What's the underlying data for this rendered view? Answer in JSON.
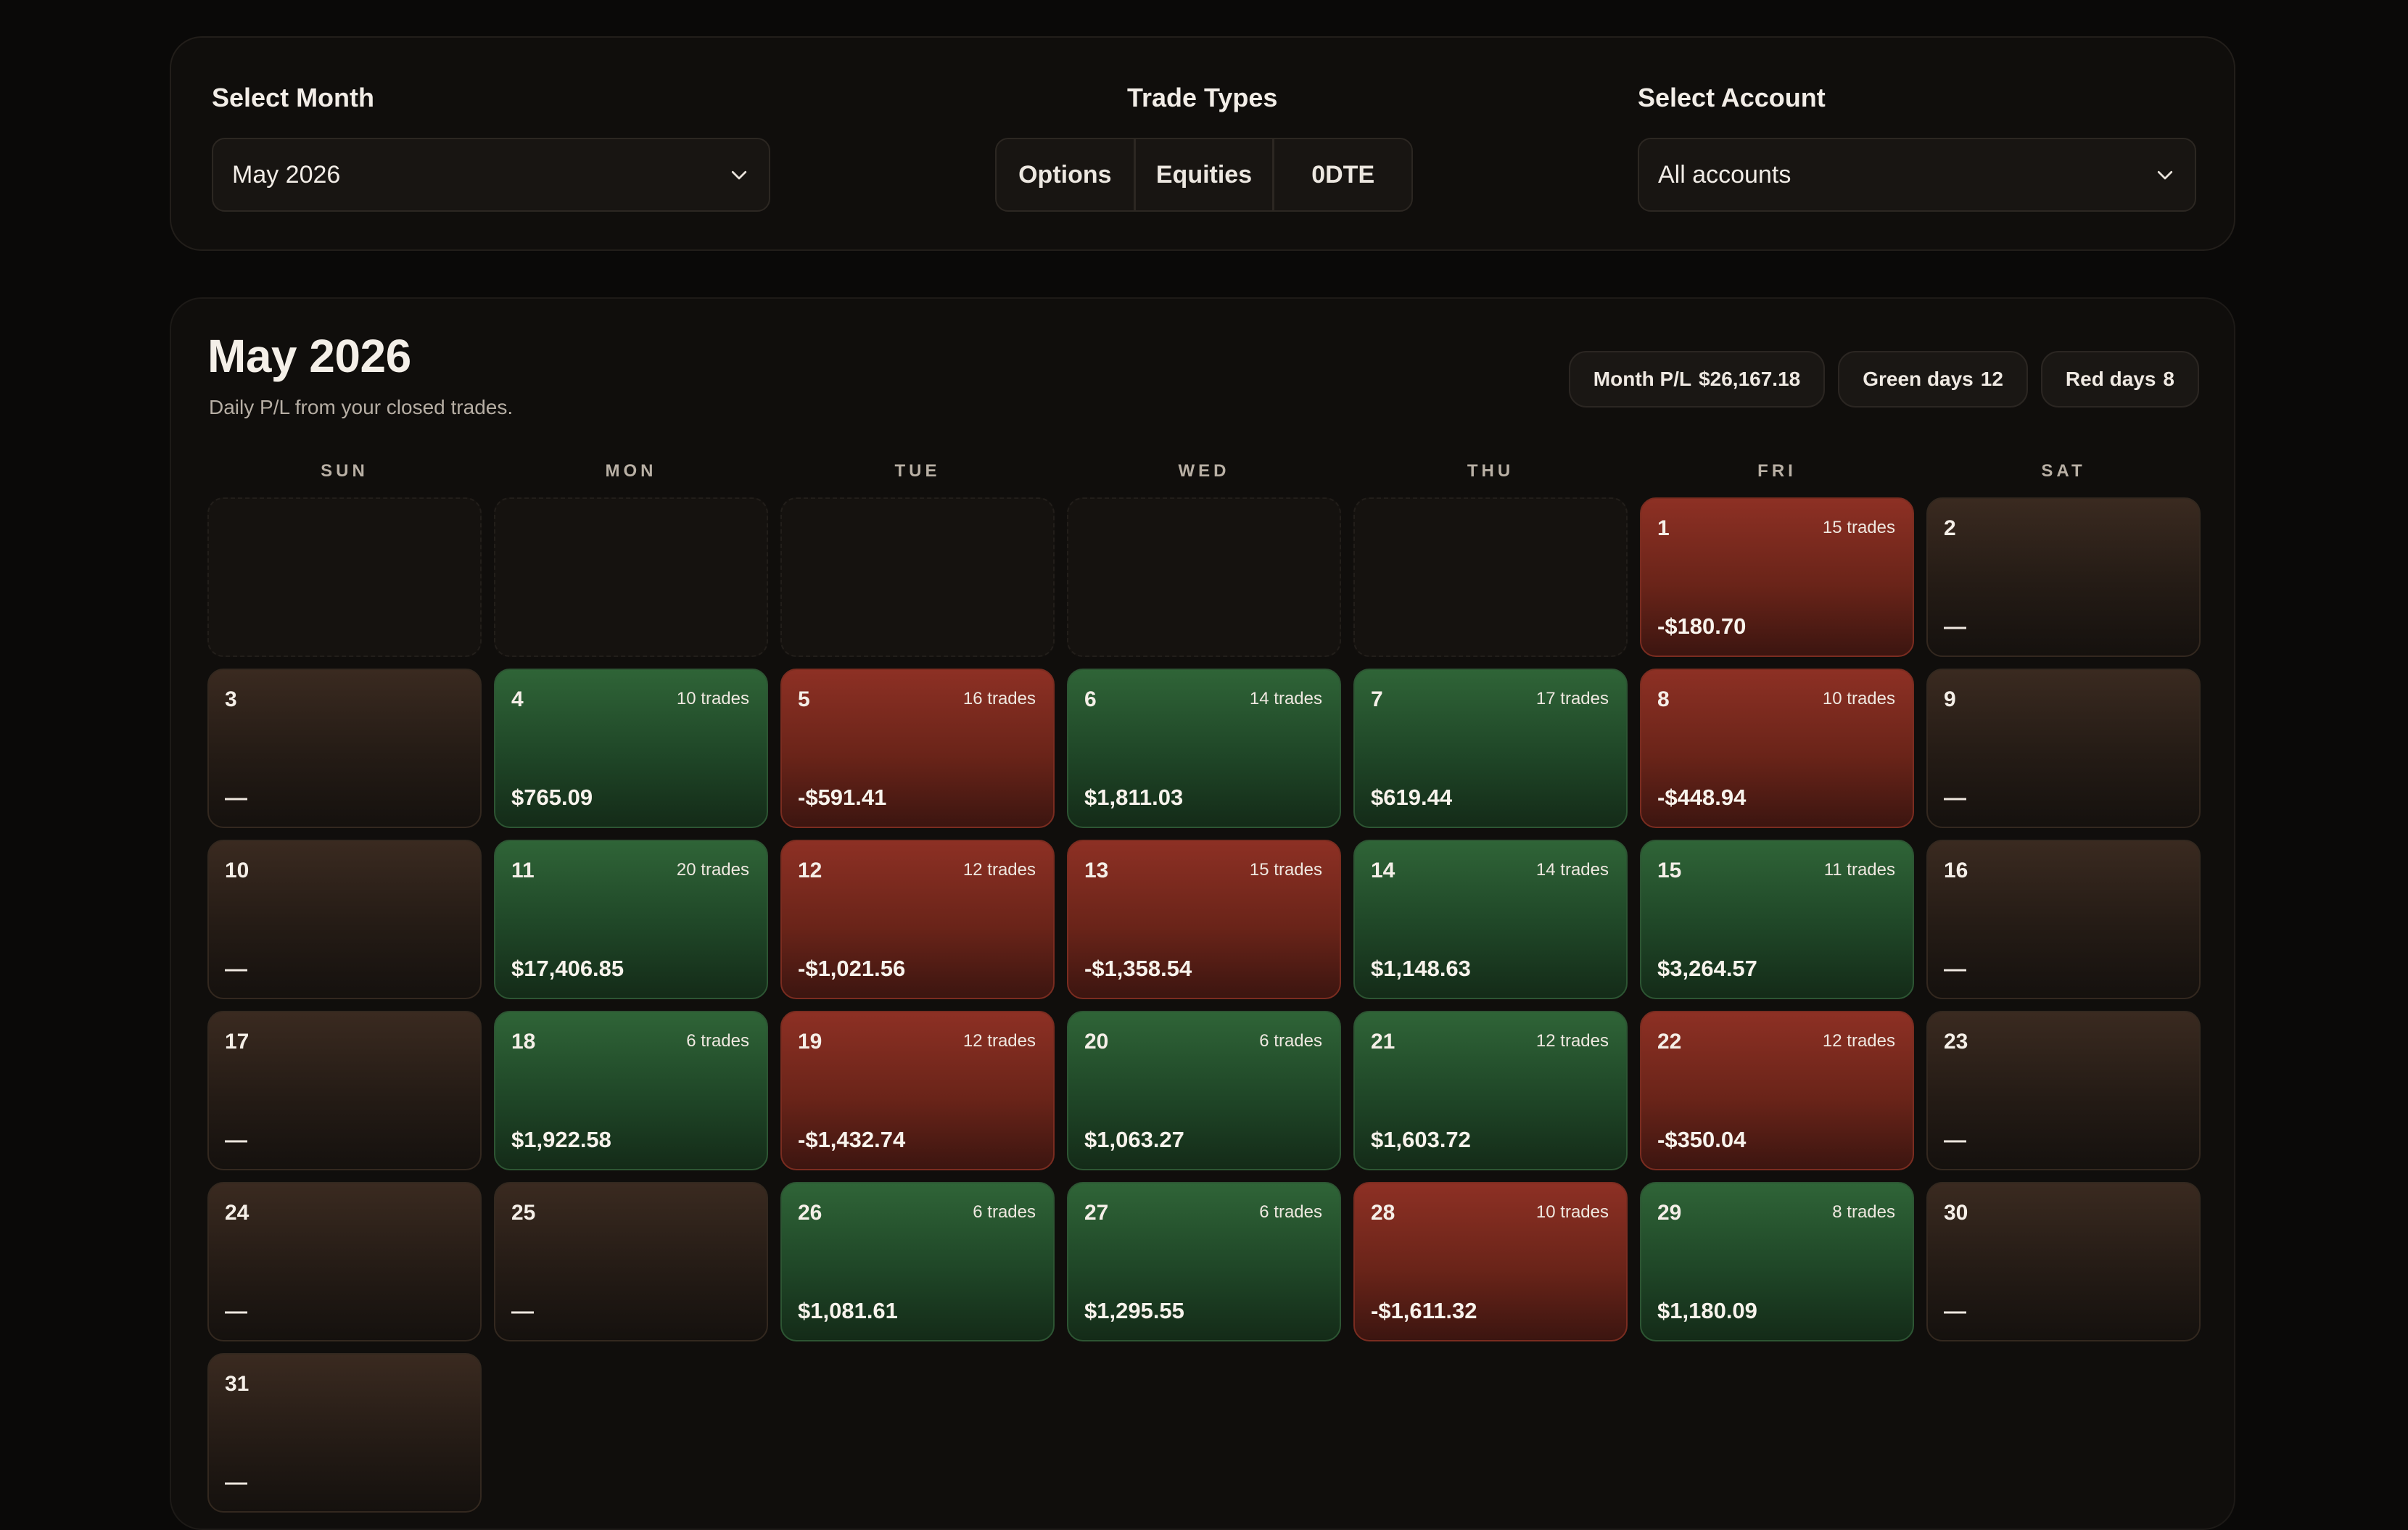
{
  "filters": {
    "month_label": "Select Month",
    "month_value": "May 2026",
    "trade_types_label": "Trade Types",
    "trade_types": [
      "Options",
      "Equities",
      "0DTE"
    ],
    "account_label": "Select Account",
    "account_value": "All accounts"
  },
  "calendar": {
    "title": "May 2026",
    "subtitle": "Daily P/L from your closed trades.",
    "summary": {
      "month_pl_label": "Month P/L",
      "month_pl": "$26,167.18",
      "green_label": "Green days",
      "green": "12",
      "red_label": "Red days",
      "red": "8"
    },
    "weekdays": [
      "SUN",
      "MON",
      "TUE",
      "WED",
      "THU",
      "FRI",
      "SAT"
    ],
    "days": [
      {
        "day": "1",
        "trades": "15 trades",
        "pl": "-$180.70",
        "status": "red"
      },
      {
        "day": "2",
        "trades": "",
        "pl": "—",
        "status": "neutral"
      },
      {
        "day": "3",
        "trades": "",
        "pl": "—",
        "status": "neutral"
      },
      {
        "day": "4",
        "trades": "10 trades",
        "pl": "$765.09",
        "status": "green"
      },
      {
        "day": "5",
        "trades": "16 trades",
        "pl": "-$591.41",
        "status": "red"
      },
      {
        "day": "6",
        "trades": "14 trades",
        "pl": "$1,811.03",
        "status": "green"
      },
      {
        "day": "7",
        "trades": "17 trades",
        "pl": "$619.44",
        "status": "green"
      },
      {
        "day": "8",
        "trades": "10 trades",
        "pl": "-$448.94",
        "status": "red"
      },
      {
        "day": "9",
        "trades": "",
        "pl": "—",
        "status": "neutral"
      },
      {
        "day": "10",
        "trades": "",
        "pl": "—",
        "status": "neutral"
      },
      {
        "day": "11",
        "trades": "20 trades",
        "pl": "$17,406.85",
        "status": "green"
      },
      {
        "day": "12",
        "trades": "12 trades",
        "pl": "-$1,021.56",
        "status": "red"
      },
      {
        "day": "13",
        "trades": "15 trades",
        "pl": "-$1,358.54",
        "status": "red"
      },
      {
        "day": "14",
        "trades": "14 trades",
        "pl": "$1,148.63",
        "status": "green"
      },
      {
        "day": "15",
        "trades": "11 trades",
        "pl": "$3,264.57",
        "status": "green"
      },
      {
        "day": "16",
        "trades": "",
        "pl": "—",
        "status": "neutral"
      },
      {
        "day": "17",
        "trades": "",
        "pl": "—",
        "status": "neutral"
      },
      {
        "day": "18",
        "trades": "6 trades",
        "pl": "$1,922.58",
        "status": "green"
      },
      {
        "day": "19",
        "trades": "12 trades",
        "pl": "-$1,432.74",
        "status": "red"
      },
      {
        "day": "20",
        "trades": "6 trades",
        "pl": "$1,063.27",
        "status": "green"
      },
      {
        "day": "21",
        "trades": "12 trades",
        "pl": "$1,603.72",
        "status": "green"
      },
      {
        "day": "22",
        "trades": "12 trades",
        "pl": "-$350.04",
        "status": "red"
      },
      {
        "day": "23",
        "trades": "",
        "pl": "—",
        "status": "neutral"
      },
      {
        "day": "24",
        "trades": "",
        "pl": "—",
        "status": "neutral"
      },
      {
        "day": "25",
        "trades": "",
        "pl": "—",
        "status": "neutral"
      },
      {
        "day": "26",
        "trades": "6 trades",
        "pl": "$1,081.61",
        "status": "green"
      },
      {
        "day": "27",
        "trades": "6 trades",
        "pl": "$1,295.55",
        "status": "green"
      },
      {
        "day": "28",
        "trades": "10 trades",
        "pl": "-$1,611.32",
        "status": "red"
      },
      {
        "day": "29",
        "trades": "8 trades",
        "pl": "$1,180.09",
        "status": "green"
      },
      {
        "day": "30",
        "trades": "",
        "pl": "—",
        "status": "neutral"
      },
      {
        "day": "31",
        "trades": "",
        "pl": "—",
        "status": "neutral"
      }
    ]
  }
}
